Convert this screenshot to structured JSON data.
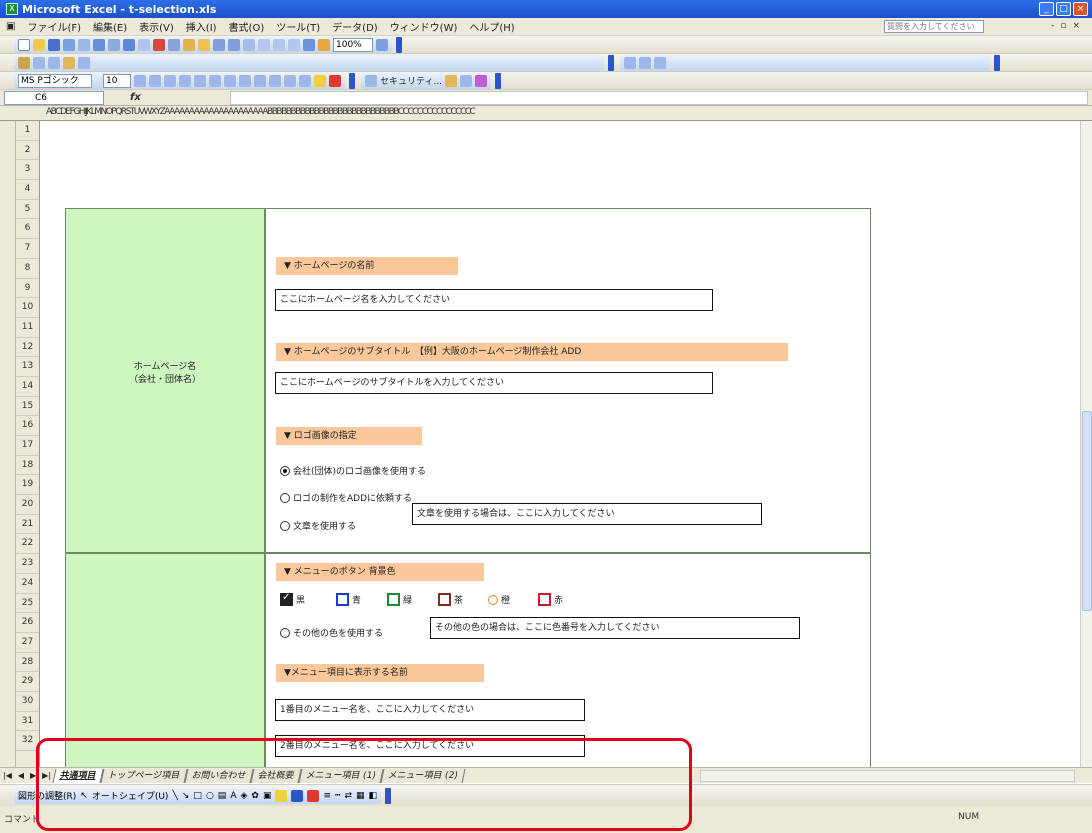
{
  "window": {
    "title": "Microsoft Excel - t-selection.xls"
  },
  "menu": [
    "ファイル(F)",
    "編集(E)",
    "表示(V)",
    "挿入(I)",
    "書式(O)",
    "ツール(T)",
    "データ(D)",
    "ウィンドウ(W)",
    "ヘルプ(H)"
  ],
  "help_placeholder": "質問を入力してください",
  "toolbar": {
    "zoom": "100%",
    "font": "MS Pゴシック",
    "size": "10",
    "security": "セキュリティ..."
  },
  "formula_bar": {
    "cell_ref": "C6",
    "fx": "fx"
  },
  "columns": "ABCDEFGHIJKLMNOPQRSTUVWXYZAAAAAAAAAAAAAAAAAAAAABBBBBBBBBBBBBBBBBBBBBBBBBBBBCCCCCCCCCCCCCCCC",
  "rows": [
    "1",
    "2",
    "3",
    "4",
    "5",
    "6",
    "7",
    "8",
    "9",
    "10",
    "11",
    "12",
    "13",
    "14",
    "15",
    "16",
    "17",
    "18",
    "19",
    "20",
    "21",
    "22",
    "23",
    "24",
    "25",
    "26",
    "27",
    "28",
    "29",
    "30",
    "31",
    "32"
  ],
  "sheet": {
    "side_label_1": "ホームページ名",
    "side_label_2": "（会社・団体名）",
    "sections": {
      "name_head": "▼ ホームページの名前",
      "name_box": "ここにホームページ名を入力してください",
      "subtitle_head": "▼ ホームページのサブタイトル　【例】大阪のホームページ制作会社 ADD",
      "subtitle_box": "ここにホームページのサブタイトルを入力してください",
      "logo_head": "▼ ロゴ画像の指定",
      "logo_opt1": "会社(団体)のロゴ画像を使用する",
      "logo_opt2": "ロゴの制作をADDに依頼する",
      "logo_opt3": "文章を使用する",
      "logo_text_box": "文章を使用する場合は、ここに入力してください",
      "menu_color_head": "▼ メニューのボタン 背景色",
      "colors": [
        "黒",
        "青",
        "緑",
        "茶",
        "橙",
        "赤"
      ],
      "other_color": "その他の色を使用する",
      "other_color_box": "その他の色の場合は、ここに色番号を入力してください",
      "menu_names_head": "▼メニュー項目に表示する名前",
      "menu_name_1": "1番目のメニュー名を、ここに入力してください",
      "menu_name_2": "2番目のメニュー名を、ここに入力してください"
    }
  },
  "tabs": [
    "共通項目",
    "トップページ項目",
    "お問い合わせ",
    "会社概要",
    "メニュー項目 (1)",
    "メニュー項目 (2)"
  ],
  "drawing": {
    "draw": "図形の調整(R)",
    "autoshape": "オートシェイプ(U)"
  },
  "status": {
    "ready": "コマンド",
    "mode": "NUM"
  }
}
